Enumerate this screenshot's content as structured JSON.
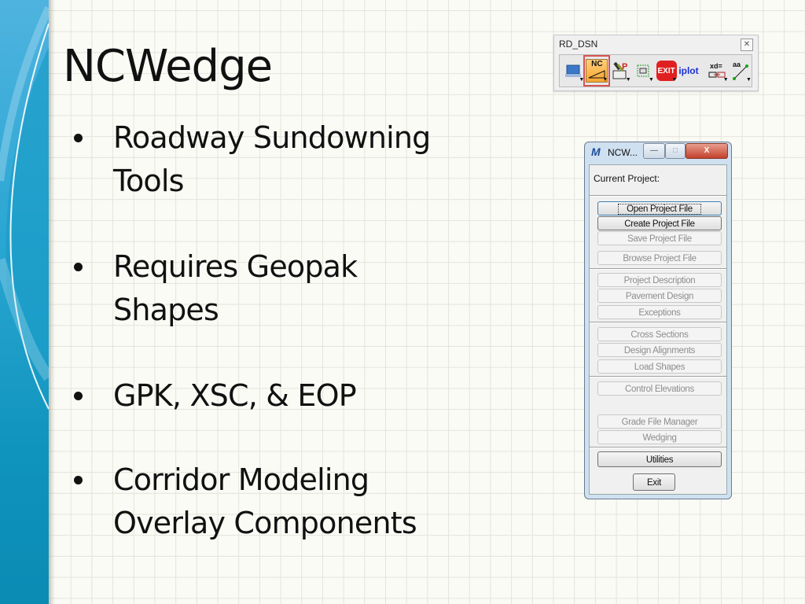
{
  "slide": {
    "title": "NCWedge",
    "bullets": [
      {
        "lines": [
          "Roadway Sundowning",
          "Tools"
        ]
      },
      {
        "lines": [
          "Requires Geopak",
          "Shapes"
        ]
      },
      {
        "lines": [
          "GPK, XSC, & EOP"
        ]
      },
      {
        "lines": [
          "Corridor Modeling",
          "Overlay Components"
        ]
      }
    ],
    "colors": {
      "sidebar": "#2aa6d2",
      "grid": "#e4e4dc",
      "background": "#fbfbf6",
      "highlight": "#d9534f"
    }
  },
  "toolbar": {
    "title": "RD_DSN",
    "close_icon": "close-icon",
    "tools": [
      {
        "name": "computer-icon",
        "label": ""
      },
      {
        "name": "nc-wedge-icon",
        "label": "NC",
        "selected": true
      },
      {
        "name": "project-tool-icon",
        "label": "P"
      },
      {
        "name": "frame-tool-icon",
        "label": ""
      },
      {
        "name": "exit-icon",
        "label": "EXIT"
      },
      {
        "name": "iplot-icon",
        "label": "iplot"
      },
      {
        "name": "xd-icon",
        "label": "xd="
      },
      {
        "name": "aa-line-icon",
        "label": "aa"
      }
    ]
  },
  "dialog": {
    "title": "NCW...",
    "minimize_label": "—",
    "maximize_label": "□",
    "close_label": "X",
    "current_project_label": "Current Project:",
    "buttons": [
      {
        "label": "Open Project File",
        "enabled": true,
        "focused": true
      },
      {
        "label": "Create Project File",
        "enabled": true
      },
      {
        "label": "Save Project File",
        "enabled": false
      },
      {
        "label": "Browse Project File",
        "enabled": false
      },
      {
        "label": "Project Description",
        "enabled": false
      },
      {
        "label": "Pavement Design",
        "enabled": false
      },
      {
        "label": "Exceptions",
        "enabled": false
      },
      {
        "label": "Cross Sections",
        "enabled": false
      },
      {
        "label": "Design Alignments",
        "enabled": false
      },
      {
        "label": "Load Shapes",
        "enabled": false
      },
      {
        "label": "Control Elevations",
        "enabled": false
      },
      {
        "label": "Grade File Manager",
        "enabled": false
      },
      {
        "label": "Wedging",
        "enabled": false
      },
      {
        "label": "Utilities",
        "enabled": true
      }
    ],
    "exit_label": "Exit"
  }
}
